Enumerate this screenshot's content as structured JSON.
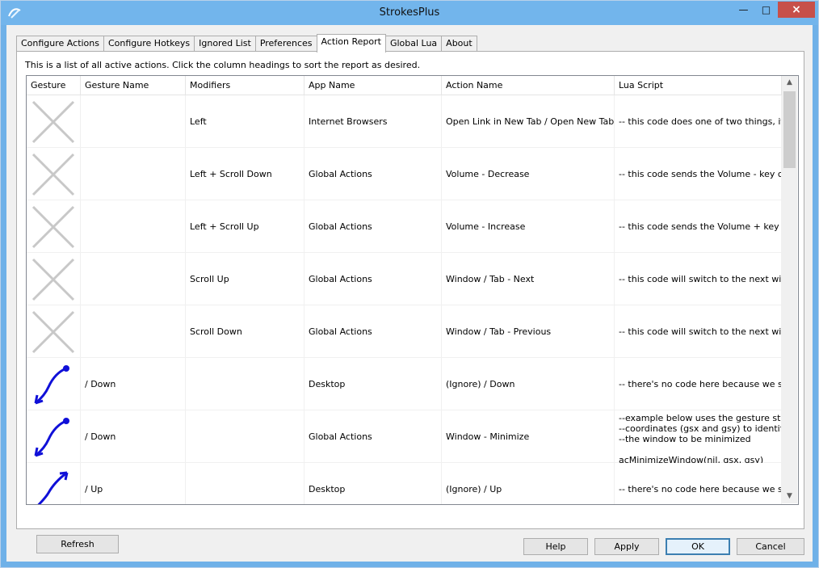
{
  "window": {
    "title": "StrokesPlus"
  },
  "tabs": [
    {
      "label": "Configure Actions"
    },
    {
      "label": "Configure Hotkeys"
    },
    {
      "label": "Ignored List"
    },
    {
      "label": "Preferences"
    },
    {
      "label": "Action Report",
      "active": true
    },
    {
      "label": "Global Lua"
    },
    {
      "label": "About"
    }
  ],
  "report": {
    "description": "This is a list of all active actions.  Click the column headings to sort the report as desired.",
    "columns": [
      "Gesture",
      "Gesture Name",
      "Modifiers",
      "App Name",
      "Action Name",
      "Lua Script"
    ],
    "rows": [
      {
        "gesture_icon": "x-icon",
        "gesture_name": "",
        "modifiers": "Left",
        "app_name": "Internet Browsers",
        "action_name": "Open Link in New Tab / Open New Tab",
        "lua_script": "-- this code does one of two things, if..."
      },
      {
        "gesture_icon": "x-icon",
        "gesture_name": "",
        "modifiers": "Left + Scroll Down",
        "app_name": "Global Actions",
        "action_name": "Volume - Decrease",
        "lua_script": "-- this code sends the Volume - key c..."
      },
      {
        "gesture_icon": "x-icon",
        "gesture_name": "",
        "modifiers": "Left + Scroll Up",
        "app_name": "Global Actions",
        "action_name": "Volume - Increase",
        "lua_script": "-- this code sends the Volume + key c..."
      },
      {
        "gesture_icon": "x-icon",
        "gesture_name": "",
        "modifiers": "Scroll Up",
        "app_name": "Global Actions",
        "action_name": "Window / Tab - Next",
        "lua_script": "-- this code will switch to the next win..."
      },
      {
        "gesture_icon": "x-icon",
        "gesture_name": "",
        "modifiers": "Scroll Down",
        "app_name": "Global Actions",
        "action_name": "Window / Tab - Previous",
        "lua_script": "-- this code will switch to the next win..."
      },
      {
        "gesture_icon": "down-left-stroke-icon",
        "gesture_name": "/ Down",
        "modifiers": "",
        "app_name": "Desktop",
        "action_name": "(Ignore) / Down",
        "lua_script": "-- there's no code here because we si..."
      },
      {
        "gesture_icon": "down-left-stroke-icon",
        "gesture_name": "/ Down",
        "modifiers": "",
        "app_name": "Global Actions",
        "action_name": "Window - Minimize",
        "lua_script": "--example below uses the gesture start\n--coordinates (gsx and gsy) to identify\n--the window to be minimized\n\nacMinimizeWindow(nil, gsx, gsy)"
      },
      {
        "gesture_icon": "up-right-stroke-icon",
        "gesture_name": "/ Up",
        "modifiers": "",
        "app_name": "Desktop",
        "action_name": "(Ignore) / Up",
        "lua_script": "-- there's no code here because we si..."
      }
    ]
  },
  "buttons": {
    "refresh": "Refresh",
    "help": "Help",
    "apply": "Apply",
    "ok": "OK",
    "cancel": "Cancel"
  },
  "colors": {
    "title_bar": "#72b5ec",
    "close_button": "#c7504a",
    "stroke_blue": "#1010d8",
    "x_icon_gray": "#c8c8c8"
  }
}
